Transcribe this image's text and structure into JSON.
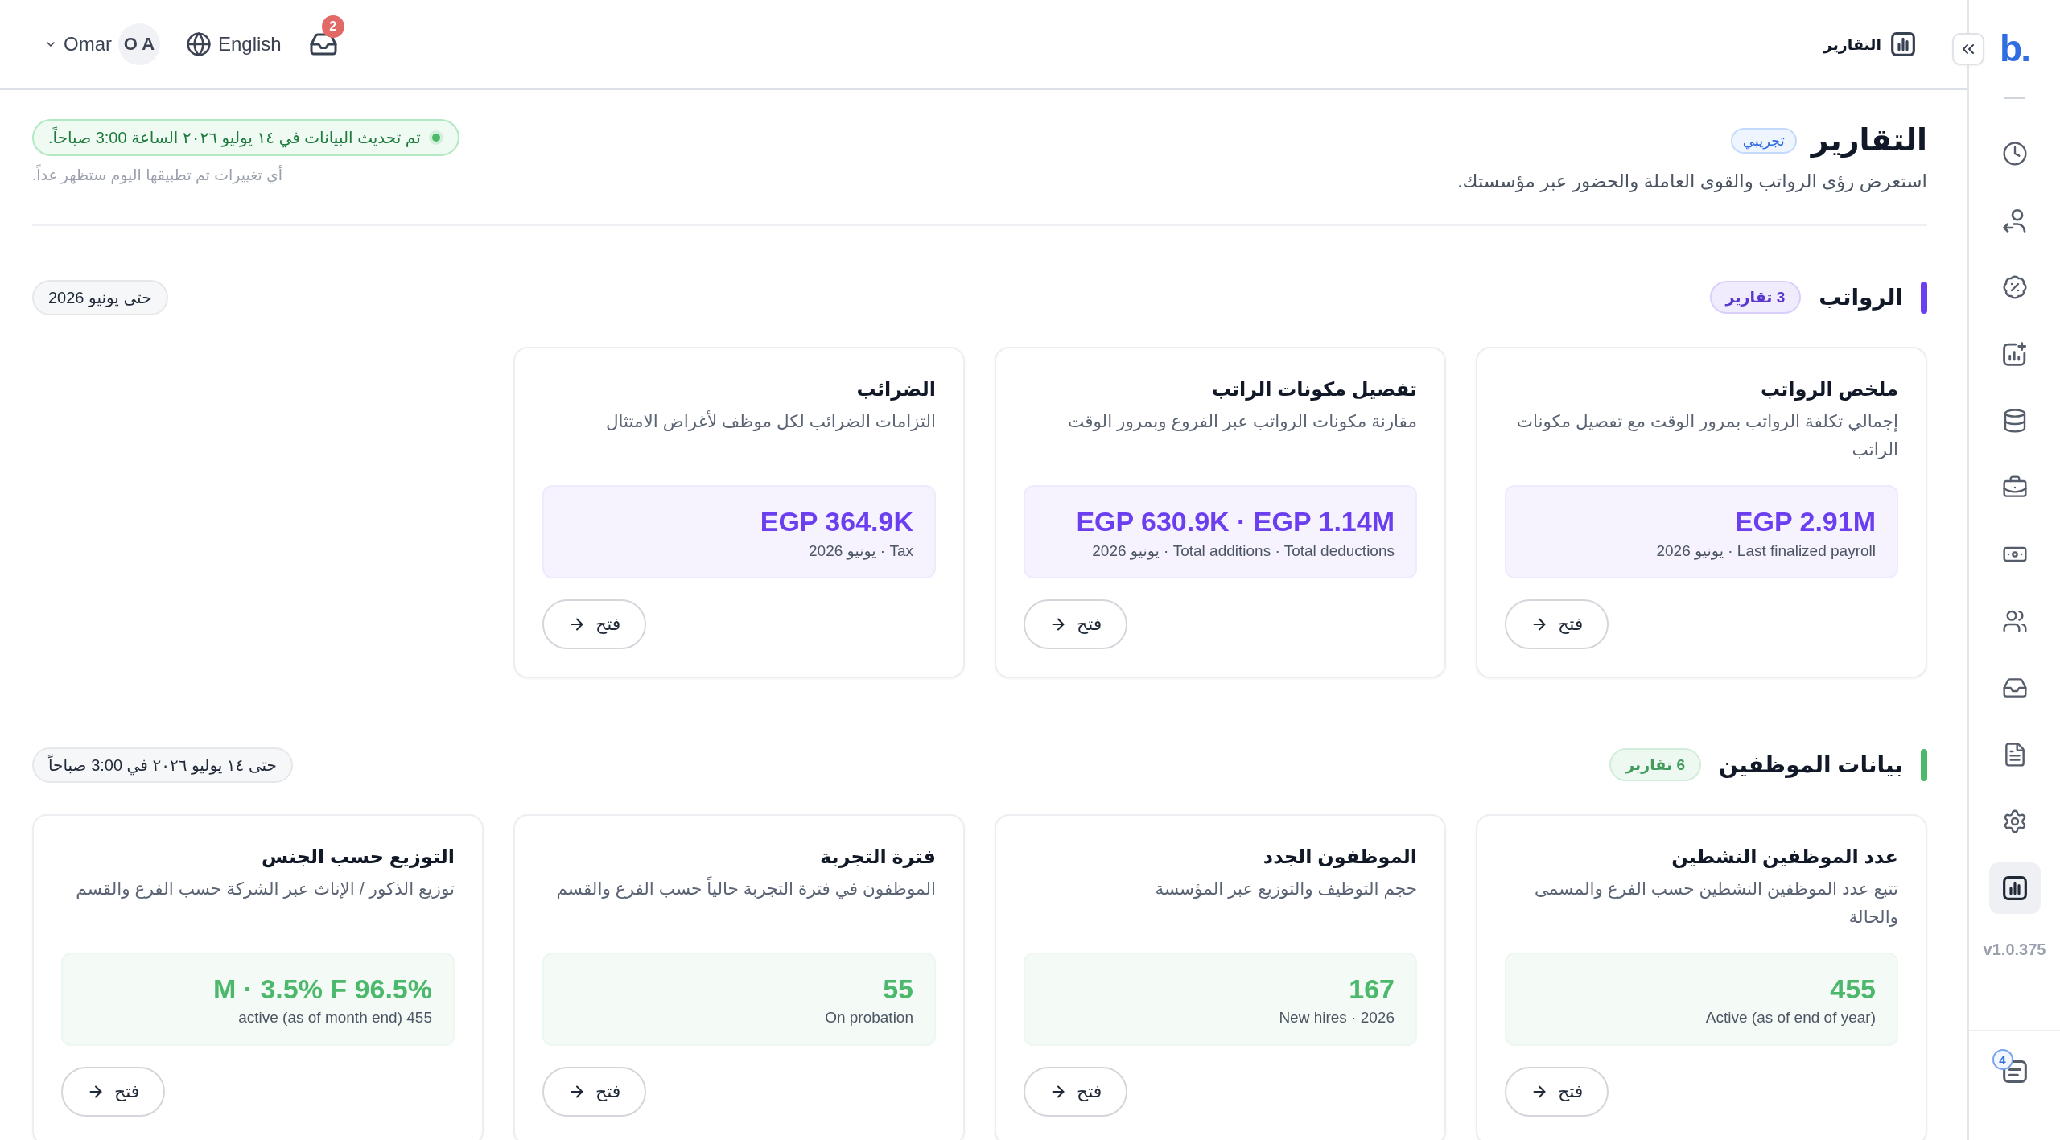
{
  "sidebar": {
    "logo": "b.",
    "items": [
      {
        "selected": false
      },
      {
        "selected": false
      },
      {
        "selected": false
      },
      {
        "selected": false
      },
      {
        "selected": false
      },
      {
        "selected": false
      },
      {
        "selected": false
      },
      {
        "selected": false
      },
      {
        "selected": false
      },
      {
        "selected": false
      },
      {
        "selected": false
      },
      {
        "selected": true
      }
    ],
    "version": "v1.0.375",
    "tasks_badge": "4"
  },
  "topbar": {
    "breadcrumb": "التقارير",
    "user": {
      "name": "Omar",
      "initials": "O A"
    },
    "language": "English",
    "inbox_badge": "2"
  },
  "header": {
    "title": "التقارير",
    "badge": "تجريبي",
    "subtitle": "استعرض رؤى الرواتب والقوى العاملة والحضور عبر مؤسستك.",
    "sync_status": "تم تحديث البيانات في ١٤ يوليو ٢٠٢٦ الساعة 3:00 صباحاً.",
    "sync_note": "أي تغييرات تم تطبيقها اليوم ستظهر غداً."
  },
  "sections": [
    {
      "title": "الرواتب",
      "count": "3 تقارير",
      "color": "#6b3ff0",
      "period": "حتى يونيو 2026",
      "reports": [
        {
          "title": "ملخص الرواتب",
          "description": "إجمالي تكلفة الرواتب بمرور الوقت مع تفصيل مكونات الراتب",
          "value": "EGP 2.91M",
          "caption": "Last finalized payroll · يونيو 2026",
          "action": "فتح"
        },
        {
          "title": "تفصيل مكونات الراتب",
          "description": "مقارنة مكونات الرواتب عبر الفروع وبمرور الوقت",
          "value": "EGP 630.9K · EGP 1.14M",
          "caption": "Total additions · Total deductions · يونيو 2026",
          "action": "فتح"
        },
        {
          "title": "الضرائب",
          "description": "التزامات الضرائب لكل موظف لأغراض الامتثال",
          "value": "EGP 364.9K",
          "caption": "Tax · يونيو 2026",
          "action": "فتح"
        }
      ]
    },
    {
      "title": "بيانات الموظفين",
      "count": "6 تقارير",
      "color": "#4cb86b",
      "period": "حتى ١٤ يوليو ٢٠٢٦ في 3:00 صباحاً",
      "reports": [
        {
          "title": "عدد الموظفين النشطين",
          "description": "تتبع عدد الموظفين النشطين حسب الفرع والمسمى والحالة",
          "value": "455",
          "caption": "Active (as of end of year)",
          "action": "فتح"
        },
        {
          "title": "الموظفون الجدد",
          "description": "حجم التوظيف والتوزيع عبر المؤسسة",
          "value": "167",
          "caption": "New hires · 2026",
          "action": "فتح"
        },
        {
          "title": "فترة التجربة",
          "description": "الموظفون في فترة التجربة حالياً حسب الفرع والقسم",
          "value": "55",
          "caption": "On probation",
          "action": "فتح"
        },
        {
          "title": "التوزيع حسب الجنس",
          "description": "توزيع الذكور / الإناث عبر الشركة حسب الفرع والقسم",
          "value": "M · 3.5% F 96.5%",
          "caption": "active (as of month end) 455",
          "action": "فتح"
        }
      ]
    }
  ]
}
